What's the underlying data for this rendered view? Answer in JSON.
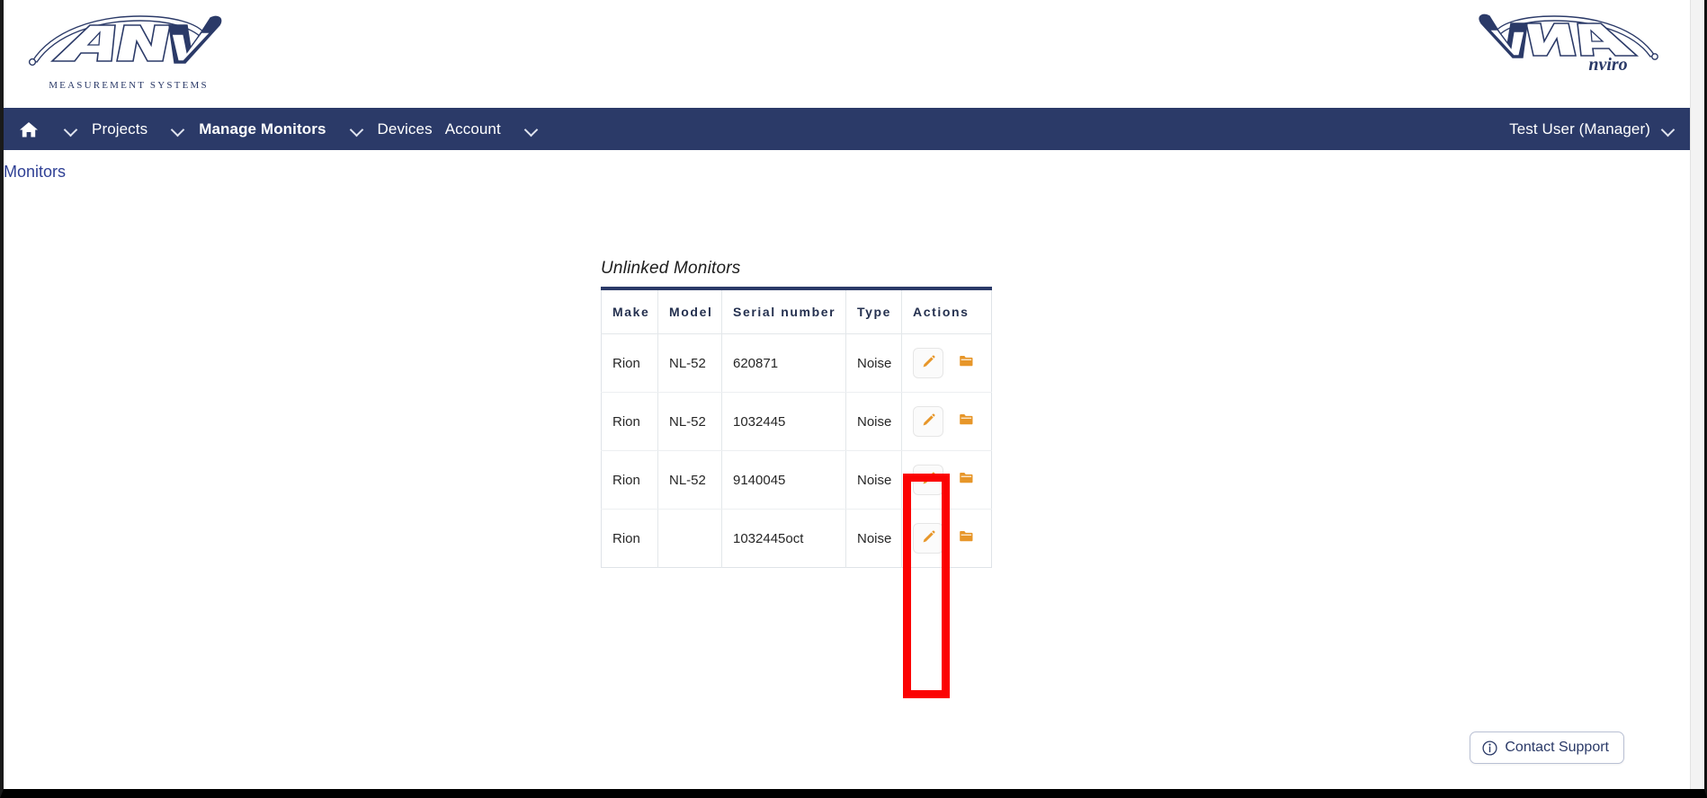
{
  "branding": {
    "left_logo_name": "ANV",
    "left_logo_tagline": "MEASUREMENT SYSTEMS",
    "right_logo_name": "ANV",
    "right_logo_tagline": "nviro",
    "navy": "#2b3a68",
    "accent_orange": "#e79629",
    "annotation_red": "#fb0303",
    "link_blue": "#2f4095"
  },
  "navbar": {
    "home_icon": "home-icon",
    "items": [
      {
        "label": "Projects",
        "bold": false,
        "has_chevron": true
      },
      {
        "label": "Manage Monitors",
        "bold": true,
        "has_chevron": true
      },
      {
        "label": "Devices",
        "bold": false,
        "has_chevron": false
      },
      {
        "label": "Account",
        "bold": false,
        "has_chevron": true
      }
    ],
    "user": "Test User (Manager)"
  },
  "breadcrumb": {
    "items": [
      {
        "label": "Monitors"
      }
    ]
  },
  "main": {
    "table_title": "Unlinked Monitors",
    "columns": [
      "Make",
      "Model",
      "Serial number",
      "Type",
      "Actions"
    ],
    "rows": [
      {
        "make": "Rion",
        "model": "NL-52",
        "serial": "620871",
        "type": "Noise",
        "actions": [
          "edit-icon",
          "folder-icon"
        ]
      },
      {
        "make": "Rion",
        "model": "NL-52",
        "serial": "1032445",
        "type": "Noise",
        "actions": [
          "edit-icon",
          "folder-icon"
        ]
      },
      {
        "make": "Rion",
        "model": "NL-52",
        "serial": "9140045",
        "type": "Noise",
        "actions": [
          "edit-icon",
          "folder-icon"
        ]
      },
      {
        "make": "Rion",
        "model": "",
        "serial": "1032445oct",
        "type": "Noise",
        "actions": [
          "edit-icon",
          "folder-icon"
        ]
      }
    ]
  },
  "footer": {
    "contact_support_label": "Contact Support",
    "contact_support_icon": "info-circle-icon"
  }
}
